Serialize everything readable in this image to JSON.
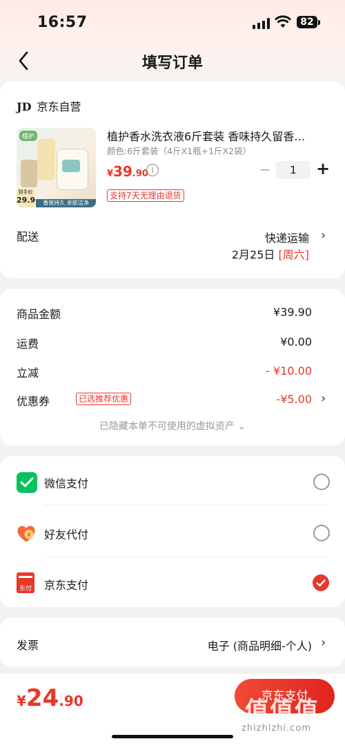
{
  "status_bar": {
    "time": "16:57",
    "battery": "82"
  },
  "header": {
    "title": "填写订单"
  },
  "order": {
    "seller": "京东自营",
    "seller_logo": "JD",
    "product": {
      "name": "植护香水洗衣液6斤套装 香味持久留香…",
      "spec": "颜色:6斤套装（4斤X1瓶+1斤X2袋）",
      "price_symbol": "¥",
      "price_int": "39",
      "price_dec": ".90",
      "quantity": "1",
      "return_tag": "支持7天无理由退货",
      "thumb_texts": {
        "brand": "植护",
        "price_label": "到手价",
        "price": "29.9",
        "banner": "香氛持久 亲肤洁净"
      }
    },
    "delivery": {
      "label": "配送",
      "method": "快递运输",
      "date": "2月25日",
      "weekday": "[周六]"
    }
  },
  "summary": {
    "rows": [
      {
        "label": "商品金额",
        "value": "¥39.90"
      },
      {
        "label": "运费",
        "value": "¥0.00"
      },
      {
        "label": "立减",
        "value": "- ¥10.00"
      },
      {
        "label": "优惠券",
        "badge": "已选推荐优惠",
        "value": "-¥5.00"
      }
    ],
    "hidden_note": "已隐藏本单不可使用的虚拟资产 ⌄"
  },
  "payment": {
    "options": [
      {
        "label": "微信支付",
        "icon": "wechat-pay-icon",
        "selected": false
      },
      {
        "label": "好友代付",
        "icon": "friend-pay-icon",
        "selected": false
      },
      {
        "label": "京东支付",
        "icon": "jd-pay-icon",
        "selected": true
      }
    ],
    "jd_icon_text": "东付"
  },
  "invoice": {
    "label": "发票",
    "value": "电子 (商品明细-个人)"
  },
  "footer": {
    "currency": "¥",
    "total_int": "24",
    "total_dec": ".90",
    "pay_label": "京东支付"
  },
  "watermark": {
    "text": "值值值",
    "url": "zhizhizhi.com"
  },
  "colors": {
    "accent": "#e8372b",
    "wechat": "#07c160"
  }
}
